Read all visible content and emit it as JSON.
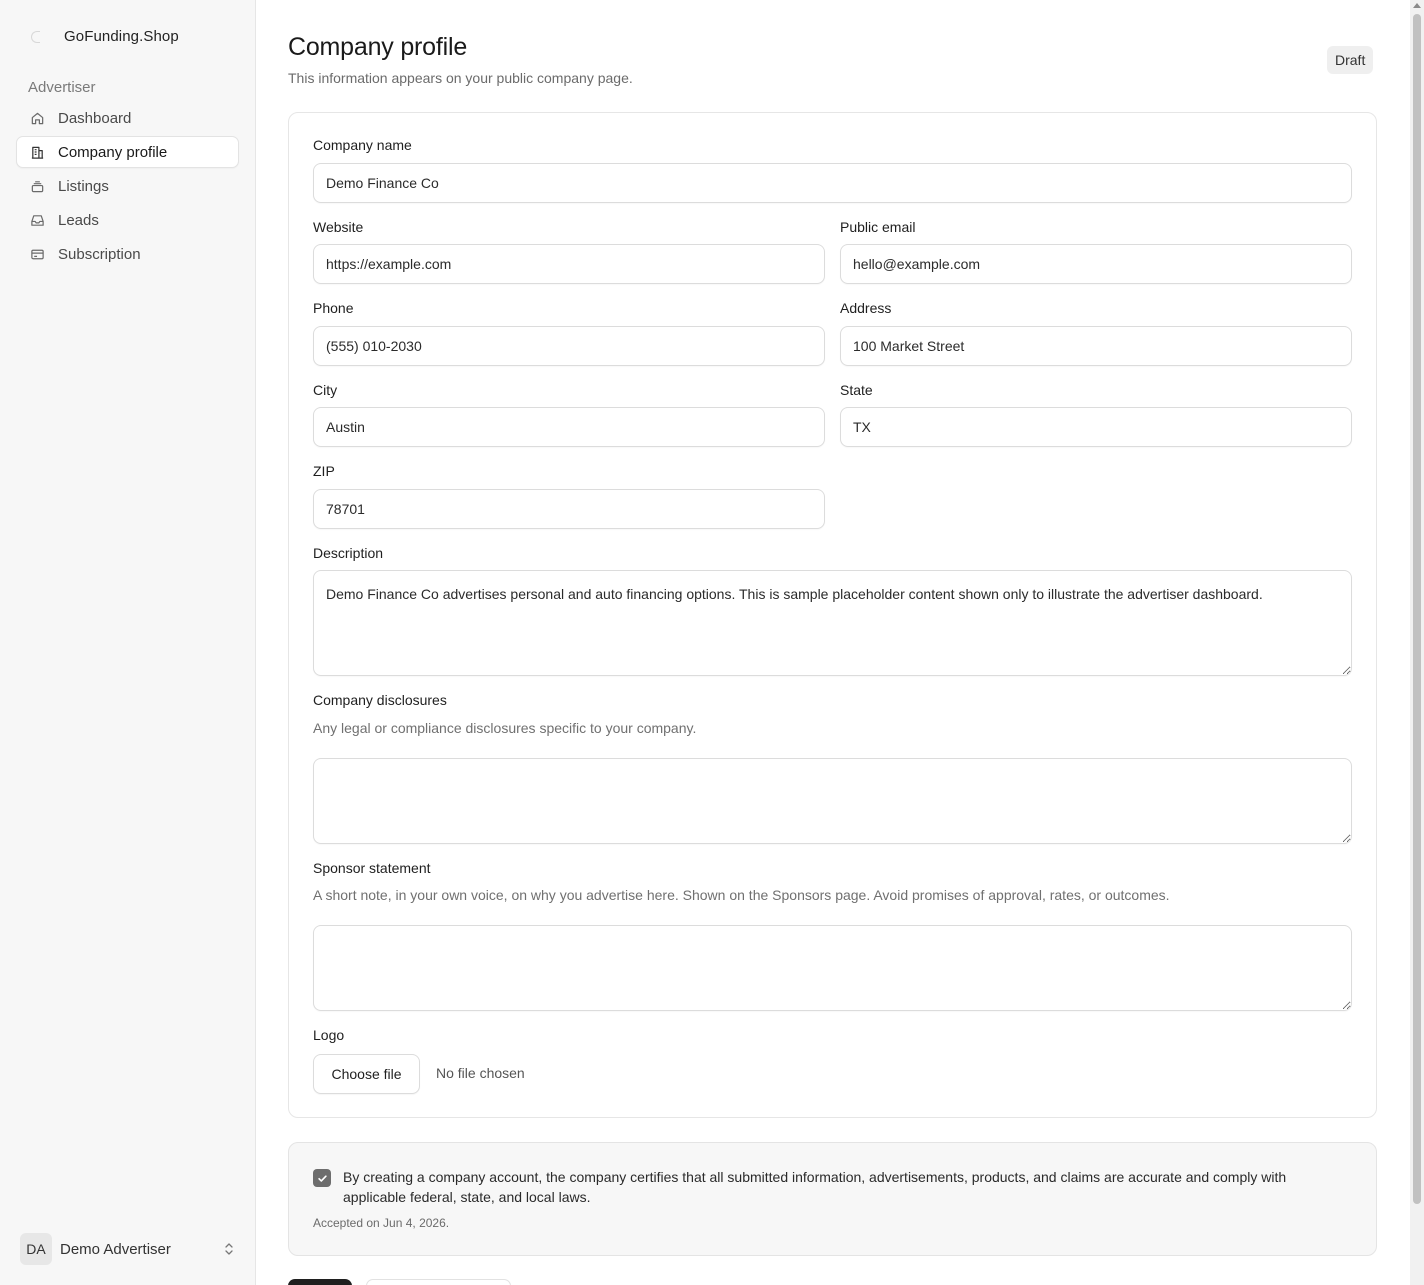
{
  "sidebar": {
    "brand": "GoFunding.Shop",
    "section_label": "Advertiser",
    "items": [
      {
        "label": "Dashboard",
        "icon": "home-icon"
      },
      {
        "label": "Company profile",
        "icon": "building-icon",
        "active": true
      },
      {
        "label": "Listings",
        "icon": "layers-icon"
      },
      {
        "label": "Leads",
        "icon": "inbox-icon"
      },
      {
        "label": "Subscription",
        "icon": "credit-card-icon"
      }
    ],
    "user": {
      "initials": "DA",
      "name": "Demo Advertiser"
    }
  },
  "header": {
    "title": "Company profile",
    "subtitle": "This information appears on your public company page.",
    "status": "Draft"
  },
  "form": {
    "company_name": {
      "label": "Company name",
      "value": "Demo Finance Co"
    },
    "website": {
      "label": "Website",
      "value": "https://example.com"
    },
    "public_email": {
      "label": "Public email",
      "value": "hello@example.com"
    },
    "phone": {
      "label": "Phone",
      "value": "(555) 010-2030"
    },
    "address": {
      "label": "Address",
      "value": "100 Market Street"
    },
    "city": {
      "label": "City",
      "value": "Austin"
    },
    "state": {
      "label": "State",
      "value": "TX"
    },
    "zip": {
      "label": "ZIP",
      "value": "78701"
    },
    "description": {
      "label": "Description",
      "value": "Demo Finance Co advertises personal and auto financing options. This is sample placeholder content shown only to illustrate the advertiser dashboard."
    },
    "disclosures": {
      "label": "Company disclosures",
      "help": "Any legal or compliance disclosures specific to your company.",
      "value": ""
    },
    "sponsor_statement": {
      "label": "Sponsor statement",
      "help": "A short note, in your own voice, on why you advertise here. Shown on the Sponsors page. Avoid promises of approval, rates, or outcomes.",
      "value": ""
    },
    "logo": {
      "label": "Logo",
      "button": "Choose file",
      "status": "No file chosen"
    }
  },
  "consent": {
    "checked": true,
    "text": "By creating a company account, the company certifies that all submitted information, advertisements, products, and claims are accurate and comply with applicable federal, state, and local laws.",
    "accepted": "Accepted on Jun 4, 2026."
  },
  "colors": {
    "accent": "#1f1f1f",
    "checkbox": "#6d6d6d",
    "sidebar_bg": "#f7f7f7"
  }
}
